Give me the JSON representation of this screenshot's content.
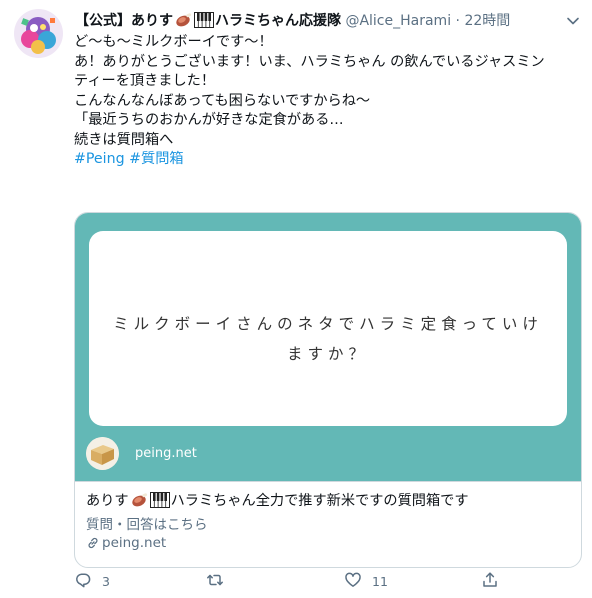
{
  "tweet": {
    "name_prefix": "【公式】ありす",
    "name_suffix": "ハラミちゃん応援隊",
    "handle": "@Alice_Harami",
    "separator": "·",
    "time": "22時間",
    "lines": [
      "ど〜も〜ミルクボーイです〜！",
      "あ！ありがとうございます！いま、ハラミちゃん の飲んでいるジャスミン",
      "ティーを頂きました！",
      "こんなんなんぼあっても困らないですからね〜",
      "「最近うちのおかんが好きな定食がある…",
      "",
      "続きは質問箱へ",
      ""
    ],
    "hashtags": "#Peing #質問箱"
  },
  "card": {
    "question_line1": "ミルクボーイさんのネタでハラミ定食っていけ",
    "question_line2": "ますか？",
    "image_domain": "peing.net",
    "title_prefix": "ありす",
    "title_suffix": "ハラミちゃん全力で推す新米ですの質問箱です",
    "description": "質問・回答はこちら",
    "link": "peing.net"
  },
  "actions": {
    "reply_count": "3",
    "retweet_count": "",
    "like_count": "11"
  },
  "colors": {
    "link": "#1b95e0",
    "muted": "#5b7083",
    "card_teal": "#63b8b6",
    "border": "#cfd9de"
  },
  "icons": [
    "avatar-icon",
    "meat-emoji-icon",
    "piano-emoji-icon",
    "caret-down-icon",
    "box-logo-icon",
    "link-icon",
    "reply-icon",
    "retweet-icon",
    "like-icon",
    "share-icon"
  ]
}
